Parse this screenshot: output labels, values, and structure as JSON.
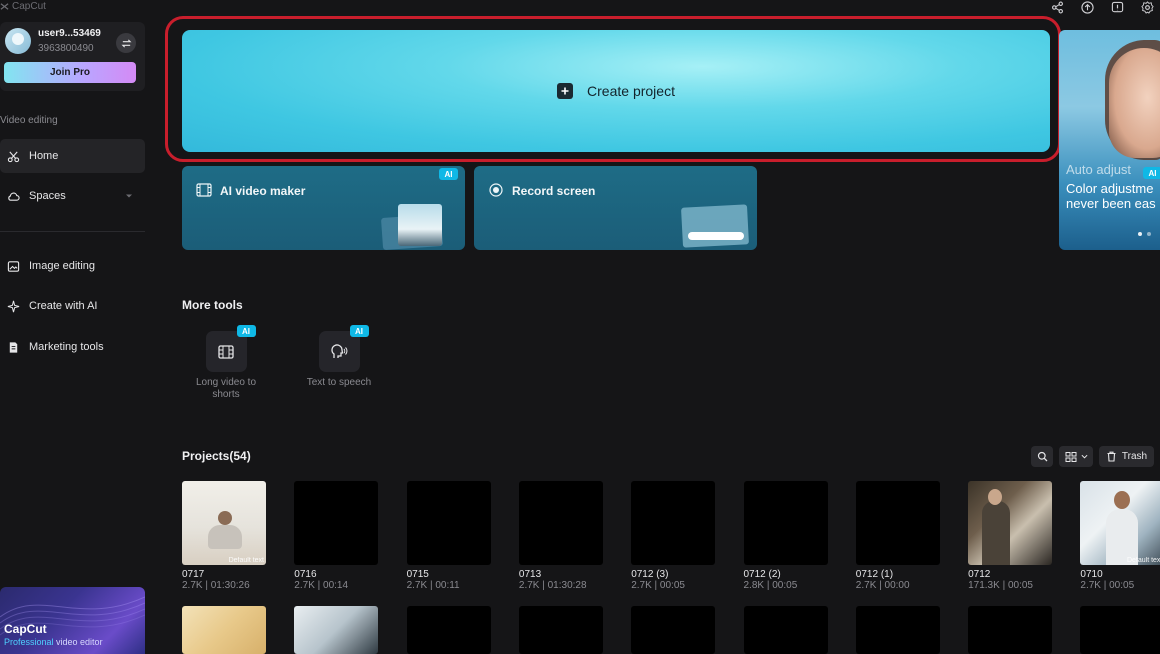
{
  "app": {
    "brand": "CapCut"
  },
  "user": {
    "name": "user9...53469",
    "id": "3963800490",
    "join_pro": "Join Pro"
  },
  "sidebar": {
    "section_label": "Video editing",
    "items": [
      {
        "label": "Home",
        "icon": "scissors-icon",
        "active": true
      },
      {
        "label": "Spaces",
        "icon": "cloud-icon"
      },
      {
        "label": "Image editing",
        "icon": "image-icon"
      },
      {
        "label": "Create with AI",
        "icon": "sparkle-icon"
      },
      {
        "label": "Marketing tools",
        "icon": "document-icon"
      }
    ],
    "promo": {
      "title": "CapCut",
      "sub_highlight": "Professional",
      "sub_rest": " video editor"
    }
  },
  "main": {
    "create_label": "Create project",
    "tools": [
      {
        "label": "AI video maker",
        "badge": "AI"
      },
      {
        "label": "Record screen"
      }
    ],
    "banner": {
      "line1": "Auto adjust",
      "line2a": "Color adjustme",
      "line2b": "never been eas",
      "badge": "AI"
    },
    "more_tools": {
      "title": "More tools",
      "items": [
        {
          "label": "Long video to shorts",
          "badge": "AI"
        },
        {
          "label": "Text to speech",
          "badge": "AI"
        }
      ]
    },
    "projects": {
      "title": "Projects(54)",
      "trash_label": "Trash",
      "items": [
        {
          "name": "0717",
          "meta": "2.7K | 01:30:26",
          "thumb": "meditation",
          "overlay": "Default text"
        },
        {
          "name": "0716",
          "meta": "2.7K | 00:14",
          "thumb": "black"
        },
        {
          "name": "0715",
          "meta": "2.7K | 00:11",
          "thumb": "black"
        },
        {
          "name": "0713",
          "meta": "2.7K | 01:30:28",
          "thumb": "black"
        },
        {
          "name": "0712 (3)",
          "meta": "2.7K | 00:05",
          "thumb": "black"
        },
        {
          "name": "0712 (2)",
          "meta": "2.8K | 00:05",
          "thumb": "black"
        },
        {
          "name": "0712 (1)",
          "meta": "2.7K | 00:00",
          "thumb": "black"
        },
        {
          "name": "0712",
          "meta": "171.3K | 00:05",
          "thumb": "classroom"
        },
        {
          "name": "0710",
          "meta": "2.7K | 00:05",
          "thumb": "teacher",
          "overlay": "Default text"
        }
      ]
    }
  },
  "colors": {
    "accent": "#0fb8e6",
    "outline": "#c81e2c",
    "card": "#1e6c86"
  }
}
